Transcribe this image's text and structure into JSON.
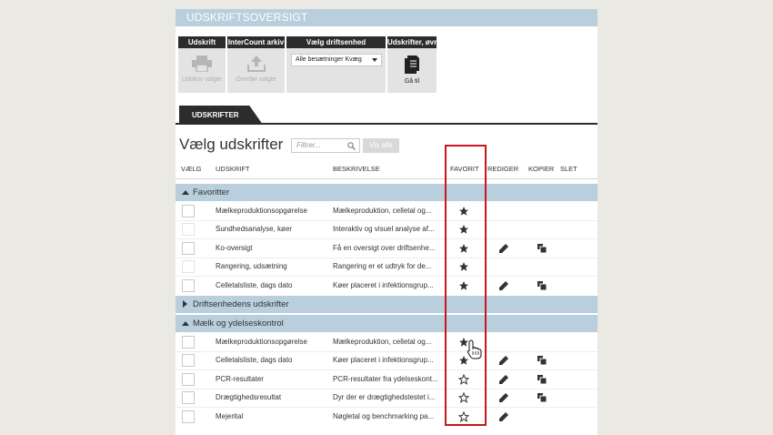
{
  "app": {
    "title": "UDSKRIFTSOVERSIGT"
  },
  "toolbar": {
    "groups": [
      {
        "header": "Udskrift",
        "button_label": "Udskriv valgte",
        "icon": "printer-icon"
      },
      {
        "header": "InterCount arkiv",
        "button_label": "Overfør valgte",
        "icon": "upload-icon"
      },
      {
        "header": "Vælg driftsenhed",
        "select_value": "Alle besætninger Kvæg"
      },
      {
        "header": "Udskrifter, øvr.",
        "button_label": "Gå til",
        "icon": "document-icon"
      }
    ]
  },
  "tabs": [
    {
      "label": "UDSKRIFTER"
    }
  ],
  "main": {
    "heading": "Vælg udskrifter",
    "filter_placeholder": "Filtrer...",
    "show_all_label": "Vis alle"
  },
  "columns": {
    "select": "VÆLG",
    "report": "UDSKRIFT",
    "description": "BESKRIVELSE",
    "favorite": "FAVORIT",
    "edit": "REDIGER",
    "copy": "KOPIER",
    "delete": "SLET"
  },
  "sections": [
    {
      "title": "Favoritter",
      "expanded": true,
      "rows": [
        {
          "name": "Mælkeproduktionsopgørelse",
          "description": "Mælkeproduktion, celletal og...",
          "favorite": true,
          "editable": false,
          "copyable": false
        },
        {
          "name": "Sundhedsanalyse, køer",
          "description": "Interaktiv og visuel analyse af...",
          "favorite": true,
          "editable": false,
          "copyable": false
        },
        {
          "name": "Ko-oversigt",
          "description": "Få en oversigt over driftsenhe...",
          "favorite": true,
          "editable": true,
          "copyable": true
        },
        {
          "name": "Rangering, udsætning",
          "description": "Rangering er et udtryk for de...",
          "favorite": true,
          "editable": false,
          "copyable": false
        },
        {
          "name": "Celletalsliste, dags dato",
          "description": "Køer placeret i infektionsgrup...",
          "favorite": true,
          "editable": true,
          "copyable": true
        }
      ]
    },
    {
      "title": "Driftsenhedens udskrifter",
      "expanded": false,
      "rows": []
    },
    {
      "title": "Mælk og ydelseskontrol",
      "expanded": true,
      "rows": [
        {
          "name": "Mælkeproduktionsopgørelse",
          "description": "Mælkeproduktion, celletal og...",
          "favorite": true,
          "editable": false,
          "copyable": false
        },
        {
          "name": "Celletalsliste, dags dato",
          "description": "Køer placeret i infektionsgrup...",
          "favorite": true,
          "editable": true,
          "copyable": true
        },
        {
          "name": "PCR-resultater",
          "description": "PCR-resultater fra ydelseskont...",
          "favorite": false,
          "editable": true,
          "copyable": true
        },
        {
          "name": "Drægtighedsresultat",
          "description": "Dyr der er drægtighedstestet i...",
          "favorite": false,
          "editable": true,
          "copyable": true
        },
        {
          "name": "Mejerital",
          "description": "Nøgletal og benchmarking pa...",
          "favorite": false,
          "editable": true,
          "copyable": false
        }
      ]
    }
  ],
  "colors": {
    "section_bg": "#b9cfdd",
    "dark": "#2c2c2c",
    "highlight": "#c8161d"
  }
}
